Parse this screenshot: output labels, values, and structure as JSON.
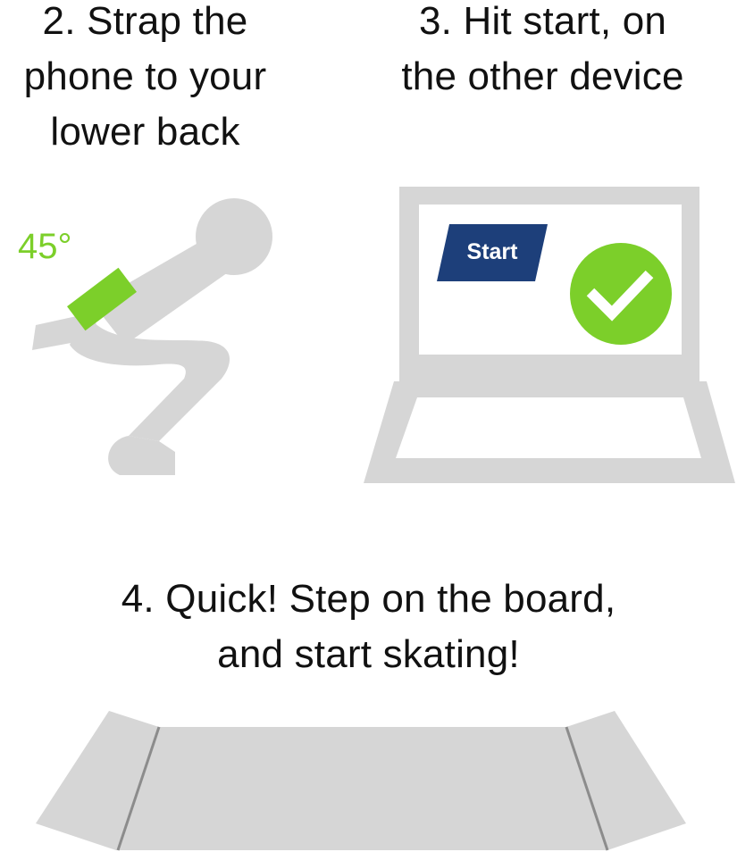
{
  "steps": [
    {
      "number": "2.",
      "lines": [
        "2. Strap the",
        "phone to your",
        "lower back"
      ]
    },
    {
      "number": "3.",
      "lines": [
        "3. Hit start, on",
        "the other device"
      ]
    },
    {
      "number": "4.",
      "lines": [
        "4. Quick! Step on the board,",
        "and start skating!"
      ]
    }
  ],
  "phone_angle": "45°",
  "device": {
    "start_button_label": "Start"
  },
  "colors": {
    "figure": "#d6d6d6",
    "phone": "#7ccf2a",
    "button": "#1d3f7a",
    "check_circle": "#7ccf2a",
    "text": "#111111"
  },
  "icons": [
    "squatting-figure-icon",
    "phone-icon",
    "laptop-icon",
    "checkmark-icon",
    "skateboard-icon"
  ]
}
